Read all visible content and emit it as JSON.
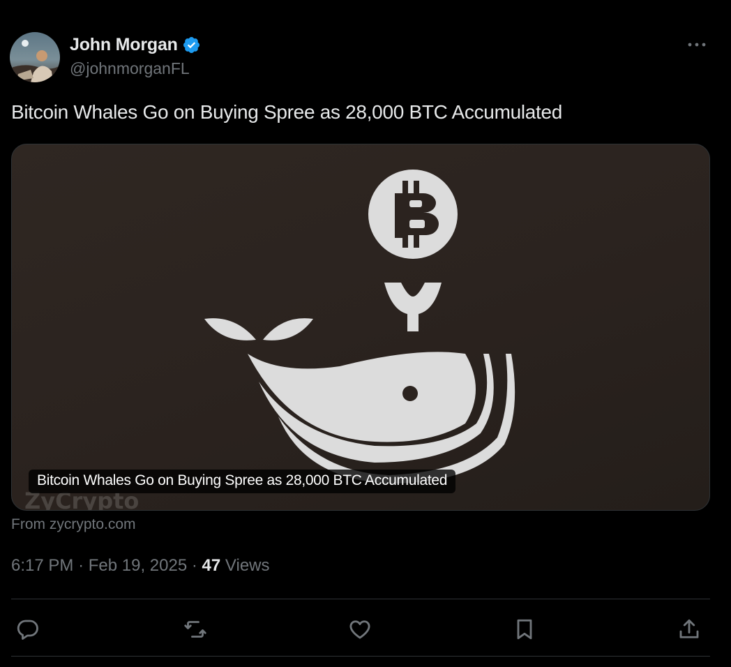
{
  "author": {
    "display_name": "John Morgan",
    "handle": "@johnmorganFL",
    "verified": true,
    "avatar_icon": "profile-photo"
  },
  "tweet": {
    "text": "Bitcoin Whales Go on Buying Spree as 28,000 BTC Accumulated"
  },
  "card": {
    "image_icon": "whale-bitcoin-illustration",
    "caption": "Bitcoin Whales Go on Buying Spree as 28,000 BTC Accumulated",
    "watermark": "ZyCrypto",
    "source": "From zycrypto.com"
  },
  "meta": {
    "time": "6:17 PM",
    "separator": "·",
    "date": "Feb 19, 2025",
    "views_count": "47",
    "views_label": "Views"
  },
  "actions": {
    "reply_icon": "reply-icon",
    "retweet_icon": "retweet-icon",
    "like_icon": "heart-icon",
    "bookmark_icon": "bookmark-icon",
    "share_icon": "share-icon"
  },
  "colors": {
    "background": "#000000",
    "text_primary": "#e7e9ea",
    "text_secondary": "#71767b",
    "verified_blue": "#1d9bf0",
    "card_background": "#2b231f",
    "illustration": "#dcdcdc"
  }
}
